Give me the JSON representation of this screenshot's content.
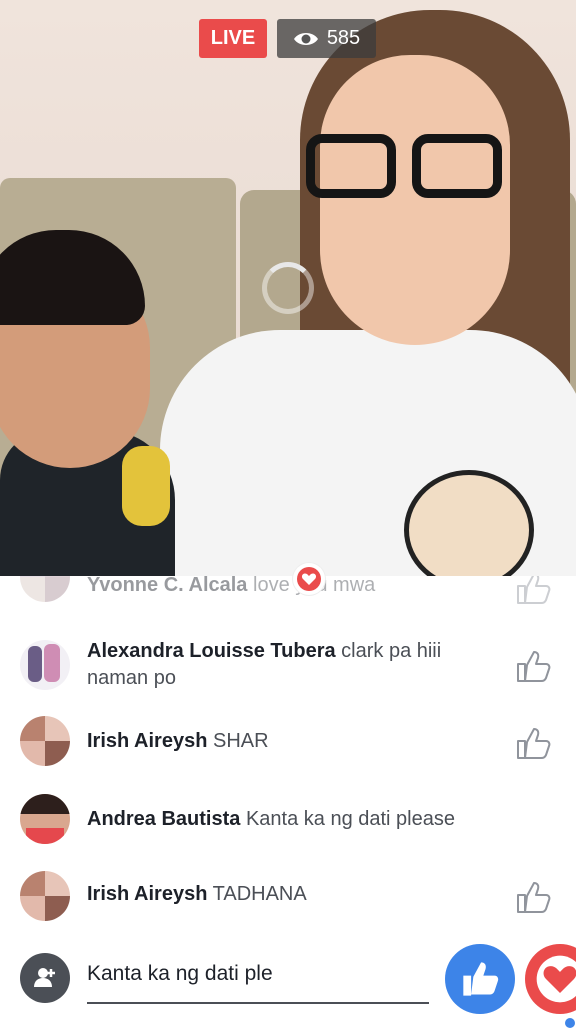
{
  "live": {
    "badge": "LIVE",
    "viewer_count": "585"
  },
  "comments": [
    {
      "name": "Yvonne C. Alcala",
      "text": "love you mwa",
      "faded": true
    },
    {
      "name": "Alexandra Louisse Tubera",
      "text": "clark pa hiii naman po"
    },
    {
      "name": "Irish Aireysh",
      "text": "SHAR"
    },
    {
      "name": "Andrea Bautista",
      "text": "Kanta ka ng dati please"
    },
    {
      "name": "Irish Aireysh",
      "text": "TADHANA"
    }
  ],
  "composer": {
    "value": "Kanta ka ng dati ple"
  },
  "colors": {
    "live_red": "#ea4b4b",
    "like_blue": "#3d84e8",
    "text_dark": "#1d2129",
    "text_gray": "#4b4f56"
  }
}
